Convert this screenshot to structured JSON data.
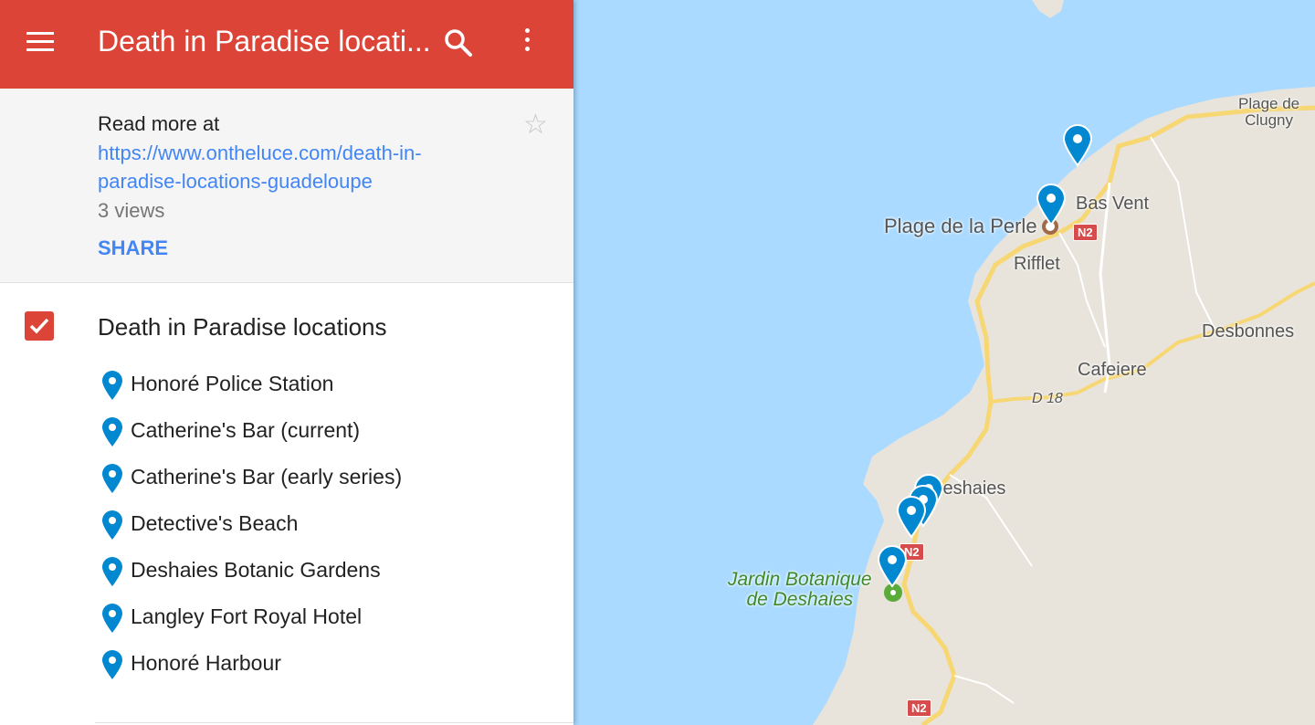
{
  "header": {
    "title": "Death in Paradise locati..."
  },
  "info": {
    "read_more": "Read more at",
    "link": "https://www.ontheluce.com/death-in-paradise-locations-guadeloupe",
    "views": "3 views",
    "share": "SHARE"
  },
  "layer": {
    "title": "Death in Paradise locations",
    "places": [
      {
        "label": "Honoré Police Station"
      },
      {
        "label": "Catherine's Bar (current)"
      },
      {
        "label": "Catherine's Bar (early series)"
      },
      {
        "label": "Detective's Beach"
      },
      {
        "label": "Deshaies Botanic Gardens"
      },
      {
        "label": "Langley Fort Royal Hotel"
      },
      {
        "label": "Honoré Harbour"
      }
    ]
  },
  "map": {
    "labels": {
      "plage_clugny": "Plage de\nClugny",
      "bas_vent": "Bas Vent",
      "plage_perle": "Plage de la Perle",
      "rifflet": "Rifflet",
      "desbonnes": "Desbonnes",
      "cafeiere": "Cafeiere",
      "d18": "D 18",
      "deshaies": "Deshaies",
      "jardin": "Jardin Botanique\nde Deshaies"
    },
    "road_shield": "N2"
  },
  "colors": {
    "brand": "#db4437",
    "link": "#4285f4",
    "pin": "#0288d1",
    "water": "#aadaff",
    "land": "#e8e4dc",
    "road": "#f7d774"
  }
}
